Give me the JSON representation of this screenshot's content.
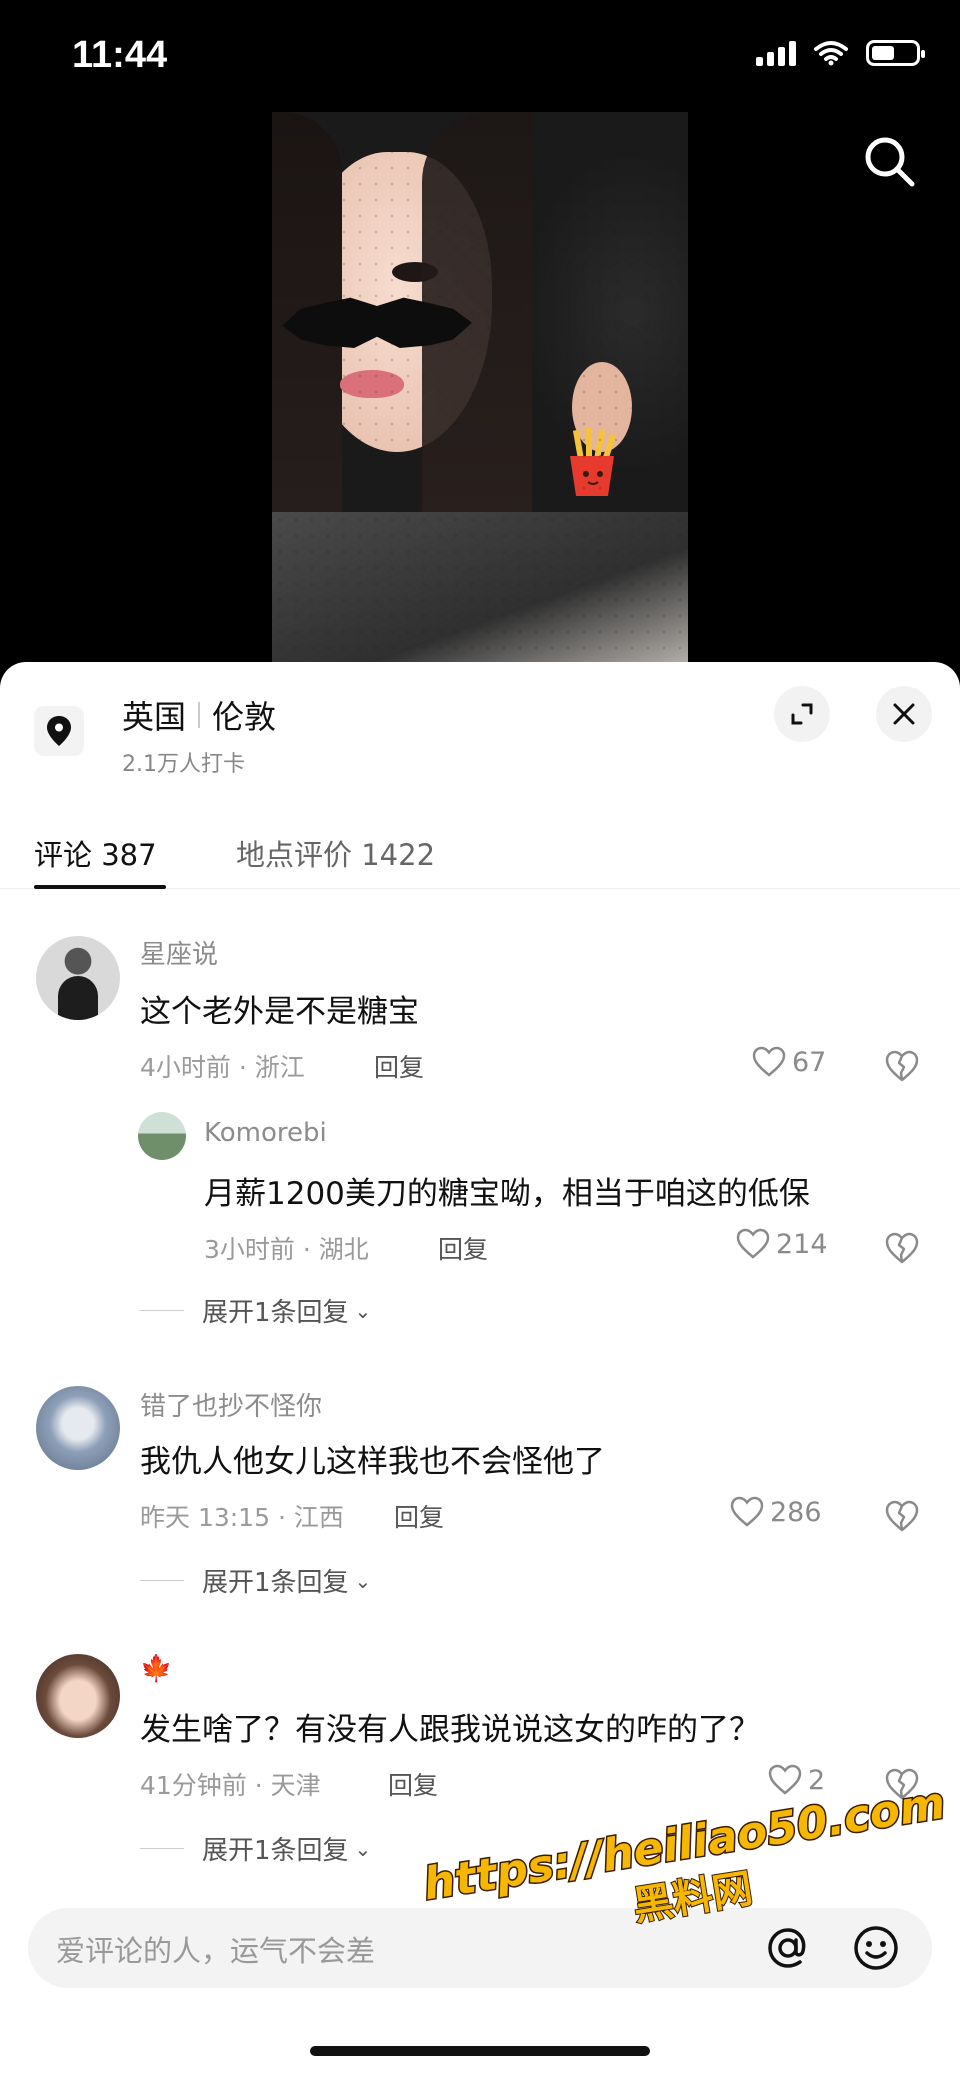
{
  "status": {
    "time": "11:44"
  },
  "location": {
    "country": "英国",
    "city": "伦敦",
    "checkins": "2.1万人打卡"
  },
  "tabs": {
    "comments": "评论 387",
    "reviews": "地点评价 1422"
  },
  "comments": [
    {
      "user": "星座说",
      "text": "这个老外是不是糖宝",
      "meta": "4小时前 · 浙江",
      "reply": "回复",
      "likes": "67"
    },
    {
      "user": "Komorebi",
      "text": "月薪1200美刀的糖宝呦，相当于咱这的低保",
      "meta": "3小时前 · 湖北",
      "reply": "回复",
      "likes": "214"
    },
    {
      "user": "错了也抄不怪你",
      "text": "我仇人他女儿这样我也不会怪他了",
      "meta": "昨天 13:15 · 江西",
      "reply": "回复",
      "likes": "286"
    },
    {
      "user": "🍁",
      "text": "发生啥了？有没有人跟我说说这女的咋的了？",
      "meta": "41分钟前 · 天津",
      "reply": "回复",
      "likes": "2"
    }
  ],
  "expand_label": "展开1条回复",
  "input": {
    "placeholder": "爱评论的人，运气不会差"
  },
  "watermark": {
    "url": "https://heiliao50.com",
    "name": "黑料网"
  }
}
